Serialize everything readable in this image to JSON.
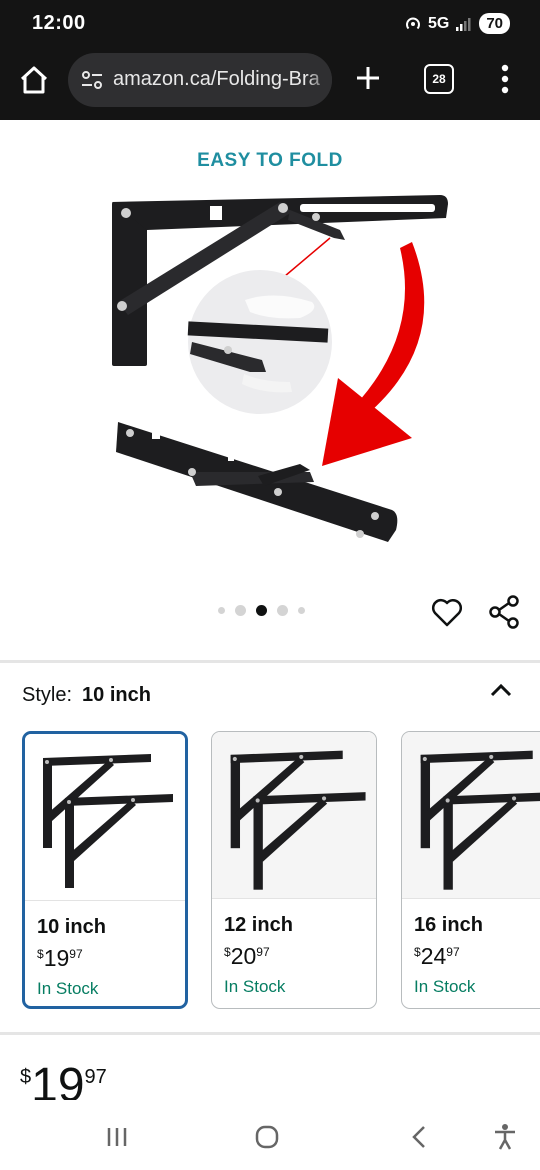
{
  "status_bar": {
    "time": "12:00",
    "network": "5G",
    "battery": "70"
  },
  "browser": {
    "url": "amazon.ca/Folding-Bra",
    "tab_count": "28"
  },
  "gallery": {
    "image_caption": "EASY TO FOLD",
    "image_count": 5,
    "active_index": 2
  },
  "style_selector": {
    "label": "Style:",
    "selected_value": "10 inch",
    "options": [
      {
        "size": "10 inch",
        "price_symbol": "$",
        "price_whole": "19",
        "price_fraction": "97",
        "availability": "In Stock",
        "selected": true
      },
      {
        "size": "12 inch",
        "price_symbol": "$",
        "price_whole": "20",
        "price_fraction": "97",
        "availability": "In Stock",
        "selected": false
      },
      {
        "size": "16 inch",
        "price_symbol": "$",
        "price_whole": "24",
        "price_fraction": "97",
        "availability": "In Stock",
        "selected": false
      }
    ]
  },
  "price": {
    "symbol": "$",
    "whole": "19",
    "fraction": "97"
  },
  "colors": {
    "accent_teal": "#1f8ea0",
    "in_stock_green": "#067d62",
    "selected_border": "#2162a1",
    "arrow_red": "#e60000"
  }
}
